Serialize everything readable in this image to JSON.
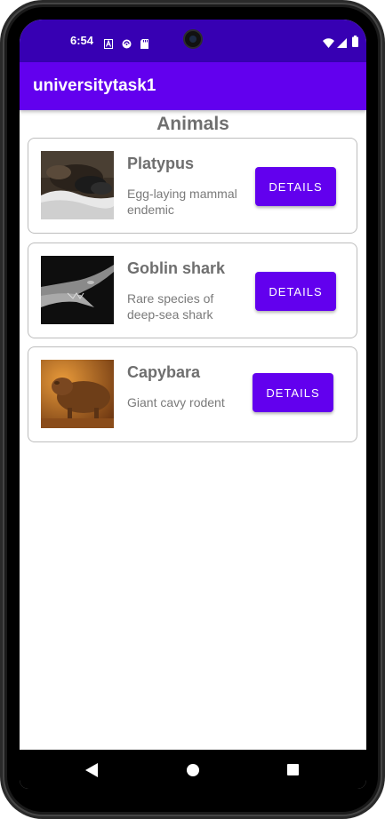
{
  "status_bar": {
    "time": "6:54",
    "icons": [
      "font-a-icon",
      "sync-icon",
      "sd-card-icon",
      "wifi-icon",
      "signal-icon",
      "battery-icon"
    ]
  },
  "app_bar": {
    "title": "universitytask1"
  },
  "page": {
    "heading": "Animals"
  },
  "animals": [
    {
      "name": "Platypus",
      "description": "Egg-laying mammal endemic",
      "button_label": "DETAILS",
      "thumbnail": "platypus-photo"
    },
    {
      "name": "Goblin shark",
      "description": "Rare species of deep-sea shark",
      "button_label": "DETAILS",
      "thumbnail": "goblin-shark-photo"
    },
    {
      "name": "Capybara",
      "description": "Giant cavy rodent",
      "button_label": "DETAILS",
      "thumbnail": "capybara-photo"
    }
  ],
  "nav_bar": {
    "icons": [
      "back-icon",
      "home-icon",
      "recents-icon"
    ]
  },
  "colors": {
    "status_bar": "#3700b3",
    "primary": "#6200ee",
    "text_secondary": "#6f6f6f",
    "card_border": "#bdbdbd"
  }
}
